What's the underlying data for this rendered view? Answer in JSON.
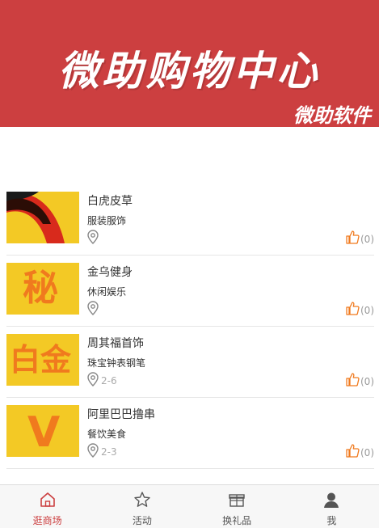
{
  "banner": {
    "title": "微助购物中心",
    "subtitle": "微助软件",
    "color": "#cc3f40"
  },
  "items": [
    {
      "name": "白虎皮草",
      "category": "服装服饰",
      "location": "",
      "likes": "(0)",
      "thumb_text": ""
    },
    {
      "name": "金乌健身",
      "category": "休闲娱乐",
      "location": "",
      "likes": "(0)",
      "thumb_text": "秘"
    },
    {
      "name": "周其福首饰",
      "category": "珠宝钟表钢笔",
      "location": "2-6",
      "likes": "(0)",
      "thumb_text": "白金"
    },
    {
      "name": "阿里巴巴撸串",
      "category": "餐饮美食",
      "location": "2-3",
      "likes": "(0)",
      "thumb_text": "V"
    }
  ],
  "tabbar": {
    "tabs": [
      {
        "label": "逛商场",
        "icon": "home-icon",
        "active": true
      },
      {
        "label": "活动",
        "icon": "star-icon",
        "active": false
      },
      {
        "label": "换礼品",
        "icon": "gift-icon",
        "active": false
      },
      {
        "label": "我",
        "icon": "user-icon",
        "active": false
      }
    ],
    "active_color": "#cc3f40"
  }
}
